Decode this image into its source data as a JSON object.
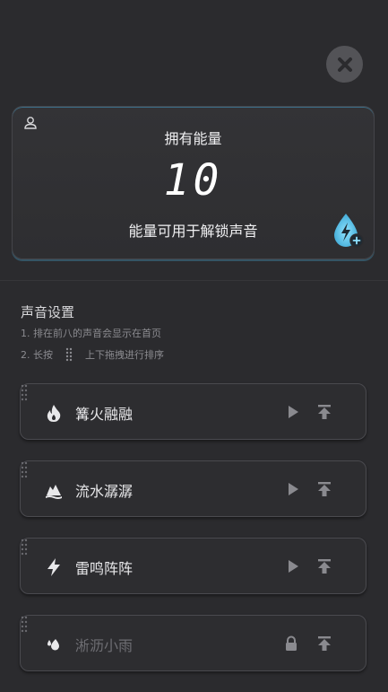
{
  "energy": {
    "title": "拥有能量",
    "value": "10",
    "description": "能量可用于解锁声音"
  },
  "settings": {
    "title": "声音设置",
    "hint1": "1. 排在前八的声音会显示在首页",
    "hint2_prefix": "2. 长按",
    "hint2_suffix": "上下拖拽进行排序"
  },
  "sounds": [
    {
      "name": "篝火融融",
      "icon": "flame-icon",
      "locked": false
    },
    {
      "name": "流水潺潺",
      "icon": "stream-icon",
      "locked": false
    },
    {
      "name": "雷鸣阵阵",
      "icon": "lightning-icon",
      "locked": false
    },
    {
      "name": "淅沥小雨",
      "icon": "rain-icon",
      "locked": true
    }
  ],
  "colors": {
    "background": "#2b2b2e",
    "accent": "#4fb6de",
    "icon_muted": "#8a8a8f"
  }
}
